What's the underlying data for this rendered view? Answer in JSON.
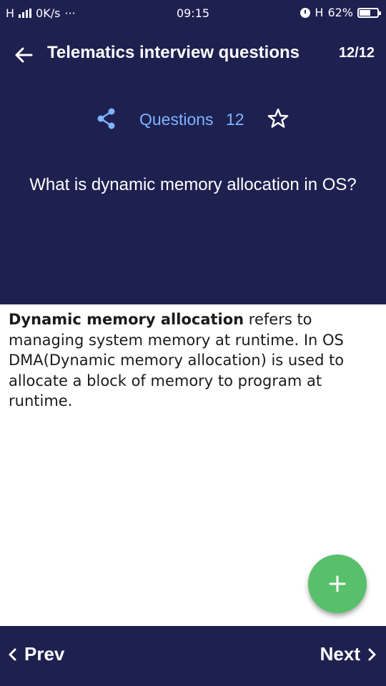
{
  "status_bar": {
    "network": "H",
    "speed": "0K/s",
    "dots": "···",
    "time": "09:15",
    "net_type": "H",
    "battery_text": "62%",
    "battery_level": 0.62
  },
  "app_bar": {
    "title": "Telematics interview questions",
    "counter": "12/12"
  },
  "meta": {
    "questions_label": "Questions",
    "questions_count": "12"
  },
  "question": {
    "text": "What is dynamic memory allocation in OS?"
  },
  "answer": {
    "bold": "Dynamic memory allocation",
    "text": " refers to managing system memory at runtime. In OS DMA(Dynamic memory allocation) is used to allocate a block of memory to program at runtime."
  },
  "nav": {
    "prev_label": "Prev",
    "next_label": "Next"
  },
  "colors": {
    "primary": "#1e2050",
    "accent": "#7fb4ff",
    "fab": "#58c06a"
  },
  "icons": {
    "back": "arrow-left-icon",
    "share": "share-icon",
    "star": "star-outline-icon",
    "fab": "plus-icon",
    "prev": "chevron-left-icon",
    "next": "chevron-right-icon"
  }
}
